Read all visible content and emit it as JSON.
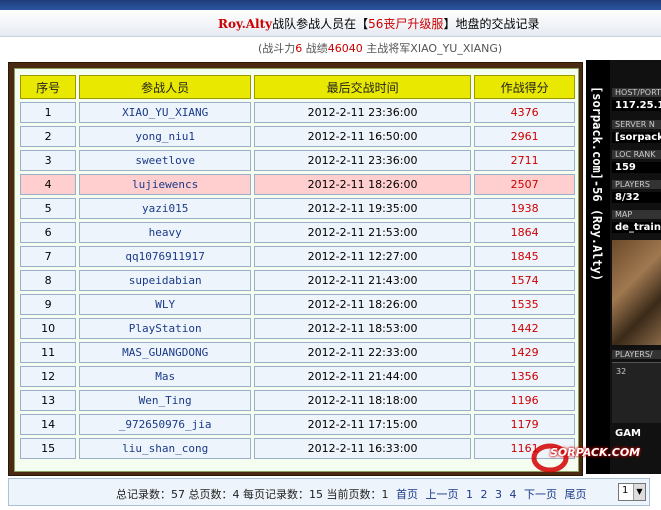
{
  "title": {
    "team": "Roy.Alty",
    "text1": "战队参战人员在【",
    "server": "56丧尸升级服",
    "text2": "】地盘的交战记录"
  },
  "subline": {
    "p1": "(战斗力",
    "power": "6",
    "p2": " 战绩",
    "record": "46040",
    "p3": " 主战将军XIAO_YU_XIANG)"
  },
  "table": {
    "headers": [
      "序号",
      "参战人员",
      "最后交战时间",
      "作战得分"
    ],
    "rows": [
      {
        "no": "1",
        "name": "XIAO_YU_XIANG",
        "time": "2012-2-11 23:36:00",
        "score": "4376"
      },
      {
        "no": "2",
        "name": "yong_niu1",
        "time": "2012-2-11 16:50:00",
        "score": "2961"
      },
      {
        "no": "3",
        "name": "sweetlove",
        "time": "2012-2-11 23:36:00",
        "score": "2711"
      },
      {
        "no": "4",
        "name": "lujiewencs",
        "time": "2012-2-11 18:26:00",
        "score": "2507"
      },
      {
        "no": "5",
        "name": "yazi015",
        "time": "2012-2-11 19:35:00",
        "score": "1938"
      },
      {
        "no": "6",
        "name": "heavy",
        "time": "2012-2-11 21:53:00",
        "score": "1864"
      },
      {
        "no": "7",
        "name": "qq1076911917",
        "time": "2012-2-11 12:27:00",
        "score": "1845"
      },
      {
        "no": "8",
        "name": "supeidabian",
        "time": "2012-2-11 21:43:00",
        "score": "1574"
      },
      {
        "no": "9",
        "name": "WLY",
        "time": "2012-2-11 18:26:00",
        "score": "1535"
      },
      {
        "no": "10",
        "name": "PlayStation",
        "time": "2012-2-11 18:53:00",
        "score": "1442"
      },
      {
        "no": "11",
        "name": "MAS_GUANGDONG",
        "time": "2012-2-11 22:33:00",
        "score": "1429"
      },
      {
        "no": "12",
        "name": "Mas",
        "time": "2012-2-11 21:44:00",
        "score": "1356"
      },
      {
        "no": "13",
        "name": "Wen_Ting",
        "time": "2012-2-11 18:18:00",
        "score": "1196"
      },
      {
        "no": "14",
        "name": "_972650976_jia",
        "time": "2012-2-11 17:15:00",
        "score": "1179"
      },
      {
        "no": "15",
        "name": "liu_shan_cong",
        "time": "2012-2-11 16:33:00",
        "score": "1161"
      }
    ]
  },
  "footer": {
    "summary": "总记录数：57 总页数：4 每页记录数：15 当前页数：1",
    "first": "首页",
    "prev": "上一页",
    "pages": [
      "1",
      "2",
      "3",
      "4"
    ],
    "next": "下一页",
    "last": "尾页",
    "page_select": "1"
  },
  "banner": {
    "vertical": "[sorpack.com]-56 (Roy.Alty)",
    "host_label": "HOST/PORT",
    "host_value": "117.25.1",
    "server_label": "SERVER N",
    "server_value": "[sorpack.",
    "loc_label": "LOC RANK",
    "loc_value": "159",
    "players_label": "PLAYERS",
    "players_value": "8/32",
    "map_label": "MAP",
    "map_value": "de_train",
    "players2_label": "PLAYERS/",
    "graph_tick": "32",
    "gam": "GAM"
  },
  "watermark": "SORPACK.COM"
}
